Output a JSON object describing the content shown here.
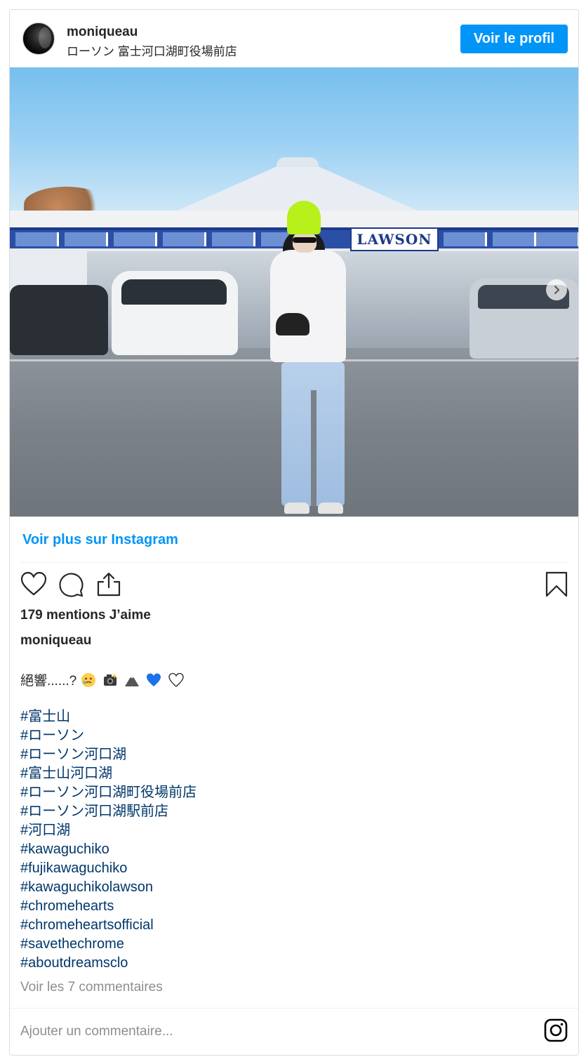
{
  "header": {
    "username": "moniqueau",
    "location": "ローソン 富士河口湖町役場前店",
    "profile_button": "Voir le profil"
  },
  "photo": {
    "sign_text": "LAWSON"
  },
  "more_link": "Voir plus sur Instagram",
  "likes": "179 mentions J’aime",
  "caption": {
    "username": "moniqueau",
    "text": "絕響......?",
    "emojis": [
      "face-holding-tears-icon",
      "camera-flash-icon",
      "mountain-icon",
      "blue-heart-icon",
      "white-heart-icon"
    ]
  },
  "hashtags": [
    "#富士山",
    "#ローソン",
    "#ローソン河口湖",
    "#富士山河口湖",
    "#ローソン河口湖町役場前店",
    "#ローソン河口湖駅前店",
    "#河口湖",
    "#kawaguchiko",
    "#fujikawaguchiko",
    "#kawaguchikolawson",
    "#chromehearts",
    "#chromeheartsofficial",
    "#savethechrome",
    "#aboutdreamsclo"
  ],
  "view_comments": "Voir les 7 commentaires",
  "comment_input": {
    "placeholder": "Ajouter un commentaire..."
  },
  "colors": {
    "primary": "#0095f6",
    "hashtag": "#00376b",
    "muted": "#8e8e8e"
  }
}
